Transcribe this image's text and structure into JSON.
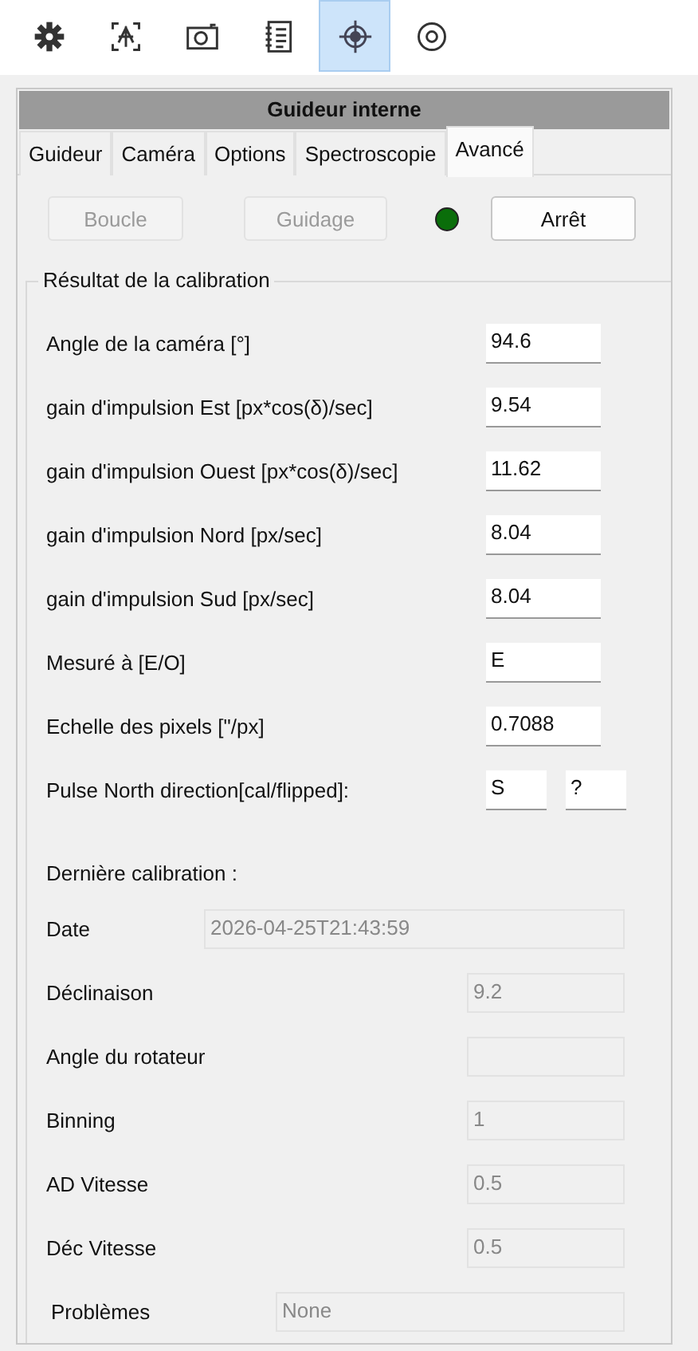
{
  "toolbar": [
    {
      "kind": "gear",
      "selected": false
    },
    {
      "kind": "focus",
      "selected": false
    },
    {
      "kind": "camera",
      "selected": false
    },
    {
      "kind": "list",
      "selected": false
    },
    {
      "kind": "crosshair",
      "selected": true
    },
    {
      "kind": "ring",
      "selected": false
    }
  ],
  "panel": {
    "title": "Guideur interne",
    "tabs": [
      {
        "label": "Guideur",
        "selected": false
      },
      {
        "label": "Caméra",
        "selected": false
      },
      {
        "label": "Options",
        "selected": false
      },
      {
        "label": "Spectroscopie",
        "selected": false
      },
      {
        "label": "Avancé",
        "selected": true
      }
    ],
    "buttons": [
      {
        "label": "Boucle",
        "disabled": true
      },
      {
        "label": "Guidage",
        "disabled": true
      }
    ],
    "status_dot": {
      "color": "#0a6e0a"
    },
    "stop_button": {
      "label": "Arrêt",
      "disabled": false
    },
    "calibration_result": {
      "title": "Résultat de la calibration",
      "rows": [
        {
          "label": "Angle de la caméra [°]",
          "values": [
            "94.6"
          ]
        },
        {
          "label": "gain d'impulsion Est [px*cos(δ)/sec]",
          "values": [
            "9.54"
          ]
        },
        {
          "label": "gain d'impulsion Ouest [px*cos(δ)/sec]",
          "values": [
            "11.62"
          ]
        },
        {
          "label": "gain d'impulsion Nord [px/sec]",
          "values": [
            "8.04"
          ]
        },
        {
          "label": "gain d'impulsion Sud [px/sec]",
          "values": [
            "8.04"
          ]
        },
        {
          "label": "Mesuré à [E/O]",
          "values": [
            "E"
          ]
        },
        {
          "label": "Echelle des pixels [\"/px]",
          "values": [
            "0.7088"
          ]
        },
        {
          "label": "Pulse North direction[cal/flipped]:",
          "values": [
            "S",
            "?"
          ]
        }
      ],
      "last_title": "Dernière calibration :",
      "last_rows": [
        {
          "label": "Date",
          "value": "2026-04-25T21:43:59",
          "kind": "date",
          "disabled": true
        },
        {
          "label": "Déclinaison",
          "value": "9.2",
          "kind": "value",
          "disabled": true
        },
        {
          "label": "Angle du rotateur",
          "kind": "value",
          "disabled": true
        },
        {
          "label": "Binning",
          "value": "1",
          "kind": "value",
          "disabled": true
        },
        {
          "label": "AD Vitesse",
          "value": "0.5",
          "kind": "value",
          "disabled": true
        },
        {
          "label": "Déc Vitesse",
          "value": "0.5",
          "kind": "value",
          "disabled": true
        },
        {
          "label": "Problèmes",
          "value": "None",
          "kind": "message",
          "disabled": true
        }
      ]
    }
  }
}
